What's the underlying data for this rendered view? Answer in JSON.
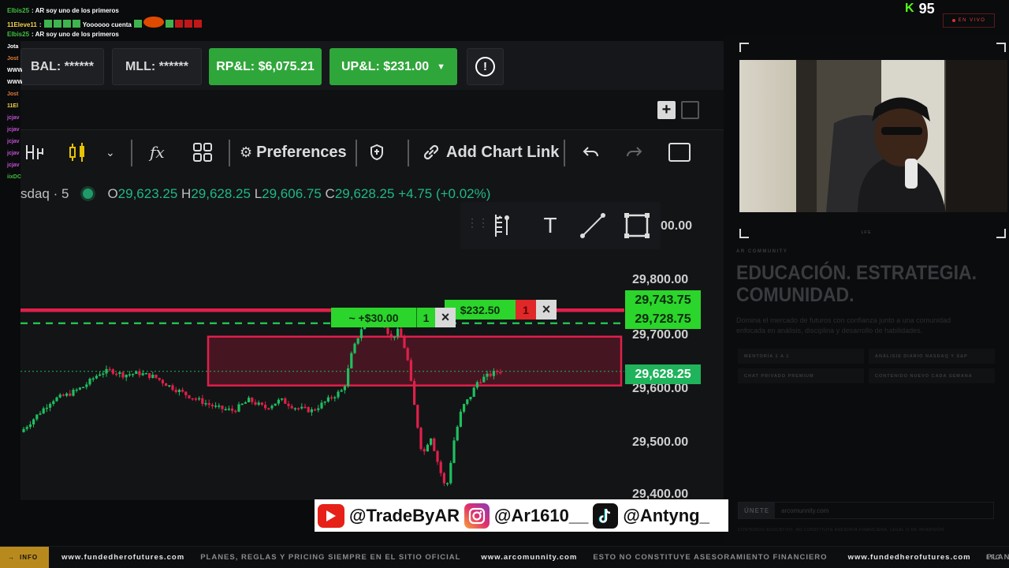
{
  "chat": {
    "lines": [
      {
        "user": "Elbis25",
        "user_color": "#3fbf3f",
        "text": "AR soy uno de los primeros",
        "emotes": 0
      },
      {
        "user": "11Eleve11",
        "user_color": "#f1d34a",
        "text": "Yoooooo cuenta",
        "emotes": 4
      },
      {
        "user": "Elbis25",
        "user_color": "#3fbf3f",
        "text": "AR soy uno de los primeros",
        "emotes": 0
      }
    ],
    "side_names": [
      {
        "name": "Jota",
        "color": "#ffffff"
      },
      {
        "name": "Jost",
        "color": "#e07a3a"
      },
      {
        "name": "WWW",
        "color": "#ffffff"
      },
      {
        "name": "WWW",
        "color": "#ffffff"
      },
      {
        "name": "Jost",
        "color": "#e07a3a"
      },
      {
        "name": "11El",
        "color": "#f1d34a"
      },
      {
        "name": "jcjav",
        "color": "#c050d0"
      },
      {
        "name": "jcjav",
        "color": "#c050d0"
      },
      {
        "name": "jcjav",
        "color": "#c050d0"
      },
      {
        "name": "jcjav",
        "color": "#c050d0"
      },
      {
        "name": "jcjav",
        "color": "#c050d0"
      },
      {
        "name": "iixDC",
        "color": "#3fbf3f"
      }
    ]
  },
  "overlay": {
    "viewer_count": "95",
    "kick_logo": "K",
    "live_label": "EN VIVO"
  },
  "account": {
    "balance": "BAL: ******",
    "mll": "MLL: ******",
    "rpl": "RP&L: $6,075.21",
    "upl": "UP&L: $231.00"
  },
  "toolbar": {
    "preferences": "Preferences",
    "add_chart_link": "Add Chart Link",
    "fx_label": "fx"
  },
  "chart": {
    "symbol": "sdaq · 5",
    "open_label": "O",
    "open": "29,623.25",
    "high_label": "H",
    "high": "29,628.25",
    "low_label": "L",
    "low": "29,606.75",
    "close_label": "C",
    "close": "29,628.25",
    "change": "+4.75 (+0.02%)",
    "partial_price": "00.00"
  },
  "chart_data": {
    "type": "candlestick",
    "price_ticks": [
      "29,800.00",
      "29,700.00",
      "29,600.00",
      "29,500.00",
      "29,400.00"
    ],
    "tags": {
      "stop": "29,743.75",
      "entry": "29,728.75",
      "last": "29,628.25"
    },
    "orders": {
      "profit_label": "~ +$30.00",
      "profit_qty": "1",
      "target_label": "$232.50",
      "target_qty": "1"
    }
  },
  "social": {
    "youtube": "@TradeByAR",
    "instagram": "@Ar1610__",
    "tiktok": "@Antyng_"
  },
  "promo": {
    "kicker": "AR COMMUNITY",
    "headline_1": "EDUCACIÓN. ESTRATEGIA.",
    "headline_2": "COMUNIDAD.",
    "body": "Domina el mercado de futuros con confianza junto a una comunidad enfocada en análisis, disciplina y desarrollo de habilidades.",
    "features": [
      "MENTORÍA 1 A 1",
      "ANÁLISIS DIARIO NASDAQ Y S&P",
      "CHAT PRIVADO PREMIUM",
      "CONTENIDO NUEVO CADA SEMANA"
    ],
    "join_button": "ÚNETE",
    "join_url": "arcomunnity.com",
    "disclaimer": "CONTENIDO EDUCATIVO. NO CONSTITUYE ASESORÍA FINANCIERA, LEGAL O DE INVERSIÓN.",
    "cam_label": "LFG"
  },
  "ticker": {
    "info": "INFO",
    "items": [
      {
        "text": "www.fundedherofutures.com",
        "style": "hi"
      },
      {
        "text": "PLANES, REGLAS Y PRICING SIEMPRE EN EL SITIO OFICIAL",
        "style": "lo"
      },
      {
        "text": "www.arcomunnity.com",
        "style": "hi"
      },
      {
        "text": "ESTO NO CONSTITUYE ASESORAMIENTO FINANCIERO",
        "style": "lo"
      },
      {
        "text": "www.fundedherofutures.com",
        "style": "hi"
      },
      {
        "text": "PLANES, REGLA",
        "style": "lo"
      }
    ],
    "end": "LFG"
  }
}
